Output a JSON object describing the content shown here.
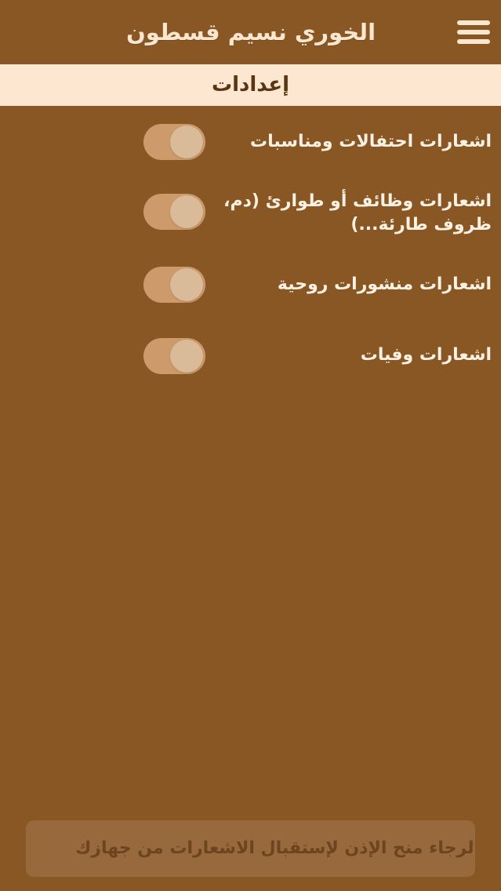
{
  "header": {
    "title": "الخوري نسيم قسطون",
    "menu_icon": "hamburger-menu-icon"
  },
  "section": {
    "title": "إعدادات"
  },
  "settings": [
    {
      "label": "اشعارات احتفالات ومناسبات",
      "enabled": true
    },
    {
      "label": "اشعارات وظائف أو طوارئ (دم، ظروف طارئة...)",
      "enabled": true
    },
    {
      "label": "اشعارات منشورات روحية",
      "enabled": true
    },
    {
      "label": "اشعارات وفيات",
      "enabled": true
    }
  ],
  "permission_notice": {
    "text": "الرجاء منح الإذن لإستقبال الاشعارات من جهازك"
  },
  "colors": {
    "background": "#895724",
    "section_bar": "#fde7d1",
    "toggle_track": "#cc9a6b",
    "toggle_knob": "#d9ba99",
    "notice_box": "#97693c"
  }
}
